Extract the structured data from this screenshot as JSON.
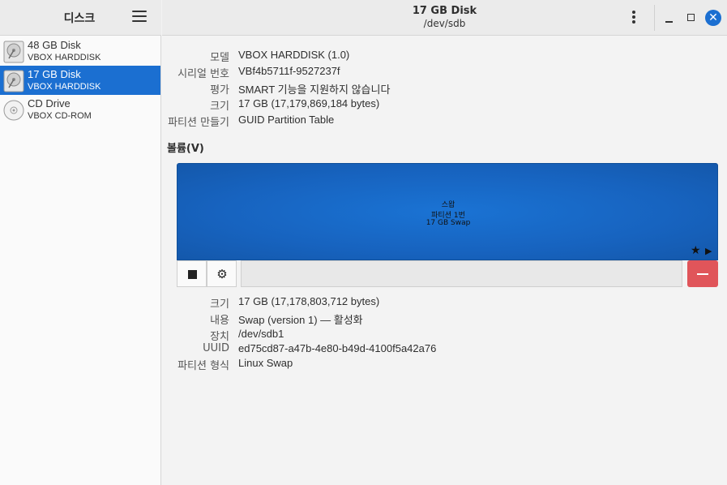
{
  "sidebar": {
    "title": "디스크",
    "disks": [
      {
        "name": "48 GB Disk",
        "sub": "VBOX HARDDISK",
        "icon": "hard-disk-icon",
        "selected": false
      },
      {
        "name": "17 GB Disk",
        "sub": "VBOX HARDDISK",
        "icon": "hard-disk-icon",
        "selected": true
      },
      {
        "name": "CD Drive",
        "sub": "VBOX CD-ROM",
        "icon": "optical-disc-icon",
        "selected": false
      }
    ]
  },
  "header": {
    "title": "17 GB Disk",
    "subtitle": "/dev/sdb"
  },
  "disk_info": [
    {
      "label": "모델",
      "value": "VBOX HARDDISK (1.0)"
    },
    {
      "label": "시리얼 번호",
      "value": "VBf4b5711f-9527237f"
    },
    {
      "label": "평가",
      "value": "SMART 기능을 지원하지 않습니다"
    },
    {
      "label": "크기",
      "value": "17 GB (17,179,869,184 bytes)"
    },
    {
      "label": "파티션 만들기",
      "value": "GUID Partition Table"
    }
  ],
  "volumes_title": "볼륨(V)",
  "volume": {
    "line1": "스왑",
    "line2": "파티션 1번",
    "line3": "17 GB Swap",
    "color": "#1b6fd1"
  },
  "partition_info": [
    {
      "label": "크기",
      "value": "17 GB (17,178,803,712 bytes)"
    },
    {
      "label": "내용",
      "value": "Swap (version 1) — 활성화"
    },
    {
      "label": "장치",
      "value": "/dev/sdb1"
    },
    {
      "label": "UUID",
      "value": "ed75cd87-a47b-4e80-b49d-4100f5a42a76"
    },
    {
      "label": "파티션 형식",
      "value": "Linux Swap"
    }
  ],
  "colors": {
    "accent": "#1b6fd1",
    "delete": "#e0555a"
  }
}
